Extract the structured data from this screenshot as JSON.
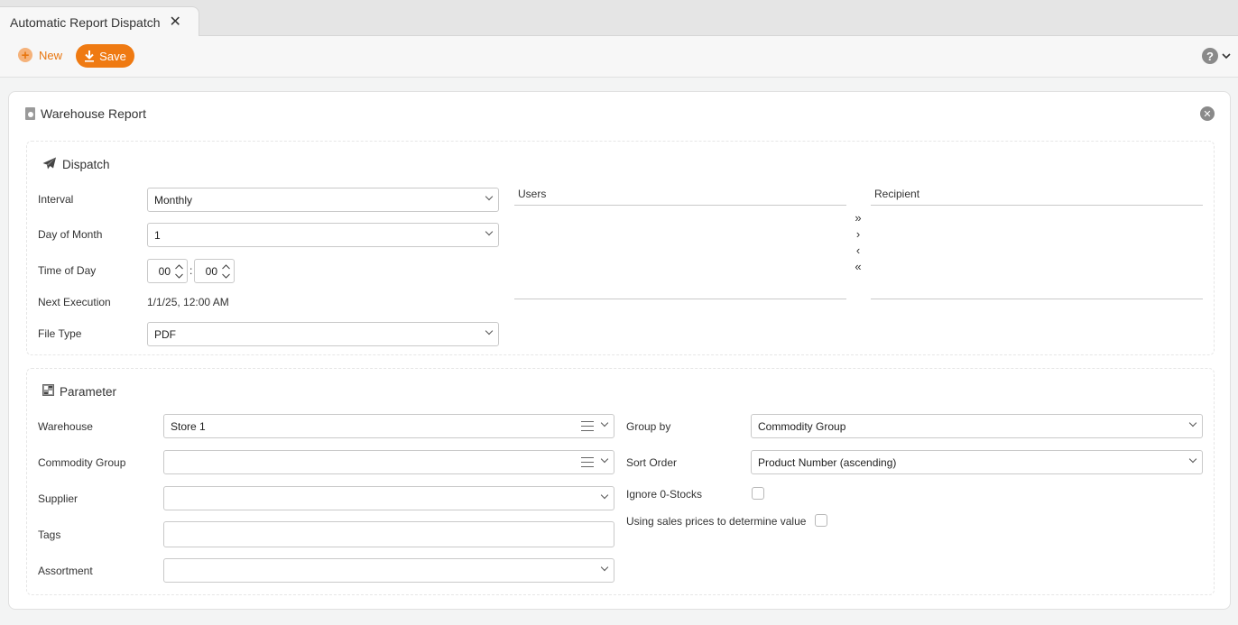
{
  "tab": {
    "title": "Automatic Report Dispatch",
    "close_icon": "close-icon"
  },
  "toolbar": {
    "new_label": "New",
    "save_label": "Save",
    "help_icon": "question-icon"
  },
  "card": {
    "title": "Warehouse Report",
    "dispatch": {
      "title": "Dispatch",
      "interval": {
        "label": "Interval",
        "value": "Monthly"
      },
      "day_of_month": {
        "label": "Day of Month",
        "value": "1"
      },
      "time_of_day": {
        "label": "Time of Day",
        "hour": "00",
        "minute": "00",
        "separator": ":"
      },
      "next_execution": {
        "label": "Next Execution",
        "value": "1/1/25, 12:00 AM"
      },
      "file_type": {
        "label": "File Type",
        "value": "PDF"
      },
      "users_label": "Users",
      "recipient_label": "Recipient",
      "transfer": {
        "add_all": "»",
        "add": "›",
        "remove": "‹",
        "remove_all": "«"
      }
    },
    "parameter": {
      "title": "Parameter",
      "warehouse": {
        "label": "Warehouse",
        "value": "Store 1"
      },
      "commodity_group": {
        "label": "Commodity Group",
        "value": ""
      },
      "supplier": {
        "label": "Supplier",
        "value": ""
      },
      "tags": {
        "label": "Tags",
        "value": ""
      },
      "assortment": {
        "label": "Assortment",
        "value": ""
      },
      "group_by": {
        "label": "Group by",
        "value": "Commodity Group"
      },
      "sort_order": {
        "label": "Sort Order",
        "value": "Product Number (ascending)"
      },
      "ignore_zero_stocks": {
        "label": "Ignore 0-Stocks",
        "checked": false
      },
      "sales_prices": {
        "label": "Using sales prices to determine value",
        "checked": false
      }
    }
  },
  "colors": {
    "accent": "#ef7a12",
    "accent_light": "#f5b27a"
  }
}
